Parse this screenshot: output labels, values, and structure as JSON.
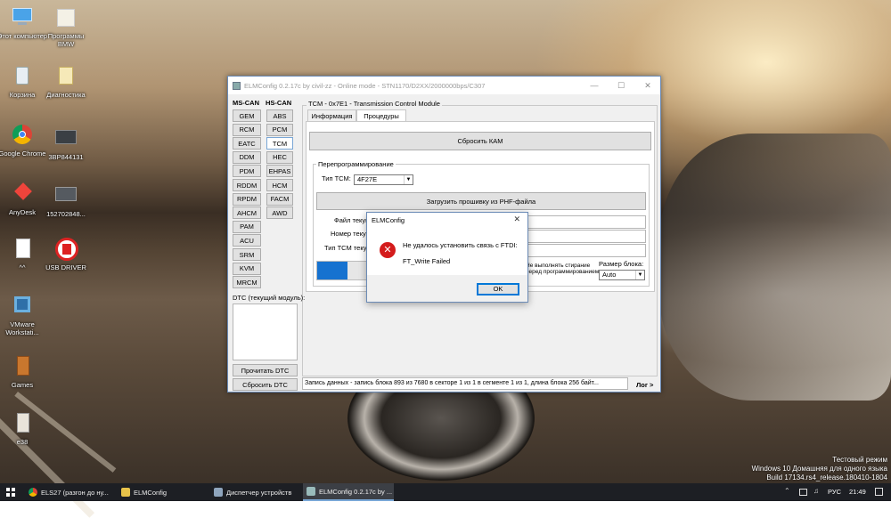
{
  "desktop": {
    "icons": [
      {
        "label": "Этот компьютер"
      },
      {
        "label": "Программы BMW"
      },
      {
        "label": "Корзина"
      },
      {
        "label": "Диагностика"
      },
      {
        "label": "Google Chrome"
      },
      {
        "label": "3BP844131"
      },
      {
        "label": "AnyDesk"
      },
      {
        "label": "152702848..."
      },
      {
        "label": "^^"
      },
      {
        "label": "USB DRIVER"
      },
      {
        "label": "VMware Workstati..."
      },
      {
        "label": "Games"
      },
      {
        "label": "e38"
      }
    ],
    "watermark": {
      "line1": "Тестовый режим",
      "line2": "Windows 10 Домашняя для одного языка",
      "line3": "Build 17134.rs4_release.180410-1804"
    }
  },
  "window": {
    "title": "ELMConfig 0.2.17c by civil-zz - Online mode - STN1170/D2XX/2000000bps/C307",
    "ms_can_header": "MS-CAN",
    "hs_can_header": "HS-CAN",
    "ms_can_modules": [
      "GEM",
      "RCM",
      "EATC",
      "DDM",
      "PDM",
      "RDDM",
      "RPDM",
      "AHCM",
      "PAM",
      "ACU",
      "SRM",
      "KVM",
      "MRCM"
    ],
    "hs_can_modules": [
      "ABS",
      "PCM",
      "TCM",
      "HEC",
      "EHPAS",
      "HCM",
      "FACM",
      "AWD"
    ],
    "selected_module": "TCM",
    "module_group_label": "TCM - 0x7E1 - Transmission Control Module",
    "tabs": [
      "Информация",
      "Процедуры"
    ],
    "active_tab": "Процедуры",
    "reset_kam_button": "Сбросить КАМ",
    "reprog_group_label": "Перепрограммирование",
    "tcm_type_label": "Тип ТСМ:",
    "tcm_type_value": "4F27E",
    "load_firmware_button": "Загрузить прошивку из PHF-файла",
    "file_label": "Файл текущ",
    "number_label": "Номер текущ",
    "tcm_type_current_label": "Тип ТСМ текущ",
    "checkbox_label_line1": "Не выполнять стирание",
    "checkbox_label_line2": "перед программированием",
    "block_size_label": "Размер блока:",
    "block_size_value": "Auto",
    "progress": 0.15,
    "dtc_label": "DTC (текущий модуль):",
    "read_dtc_button": "Прочитать DTC",
    "clear_dtc_button": "Сбросить DTC",
    "status_text": "Запись данных - запись блока 893 из 7680 в секторе 1 из 1 в сегменте 1 из 1, длина блока 256 байт...",
    "log_button": "Лог >"
  },
  "dialog": {
    "title": "ELMConfig",
    "message_line1": "Не удалось установить связь с FTDI:",
    "message_line2": "FT_Write Failed",
    "ok_button": "OK"
  },
  "taskbar": {
    "items": [
      {
        "label": "ELS27 (разгон до ну..."
      },
      {
        "label": "ELMConfig"
      },
      {
        "label": "Диспетчер устройств"
      },
      {
        "label": "ELMConfig 0.2.17c by ..."
      }
    ],
    "language": "РУС",
    "clock": "21:49"
  },
  "colors": {
    "accent": "#0078d7",
    "error": "#d41c1c",
    "progress": "#1672d0"
  }
}
